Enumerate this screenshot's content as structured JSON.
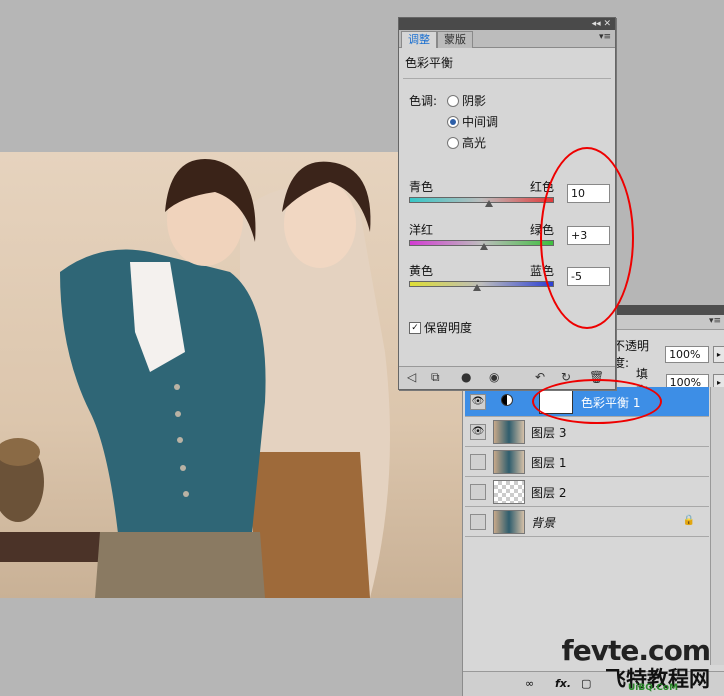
{
  "adjustments_panel": {
    "tabs": [
      "调整",
      "蒙版"
    ],
    "heading": "色彩平衡",
    "tone_label": "色调:",
    "tone_options": [
      "阴影",
      "中间调",
      "高光"
    ],
    "selected_tone": "中间调",
    "sliders": [
      {
        "left": "青色",
        "right": "红色",
        "value": "10",
        "level": 0.55
      },
      {
        "left": "洋红",
        "right": "绿色",
        "value": "+3",
        "level": 0.52
      },
      {
        "left": "黄色",
        "right": "蓝色",
        "value": "-5",
        "level": 0.47
      }
    ],
    "preserve_luminosity": "保留明度",
    "preserve_checked": true
  },
  "layers_panel": {
    "opacity_label": "不透明度:",
    "opacity_value": "100%",
    "fill_label": "填充:",
    "fill_value": "100%",
    "layers": [
      {
        "name": "色彩平衡 1",
        "selected": true,
        "visible": true,
        "thumb": "adjustment"
      },
      {
        "name": "图层 3",
        "selected": false,
        "visible": true,
        "thumb": "photo"
      },
      {
        "name": "图层 1",
        "selected": false,
        "visible": false,
        "thumb": "photo"
      },
      {
        "name": "图层 2",
        "selected": false,
        "visible": false,
        "thumb": "checker"
      },
      {
        "name": "背景",
        "selected": false,
        "visible": false,
        "thumb": "photo",
        "locked": true
      }
    ],
    "bottom_fx": "fx."
  },
  "watermark": {
    "line1": "fevte.com",
    "line2": "飞特教程网",
    "line3": "UiBQ.CoM"
  },
  "colors": {
    "selected_layer": "#3d8ee6",
    "annotation_red": "#e00000"
  }
}
